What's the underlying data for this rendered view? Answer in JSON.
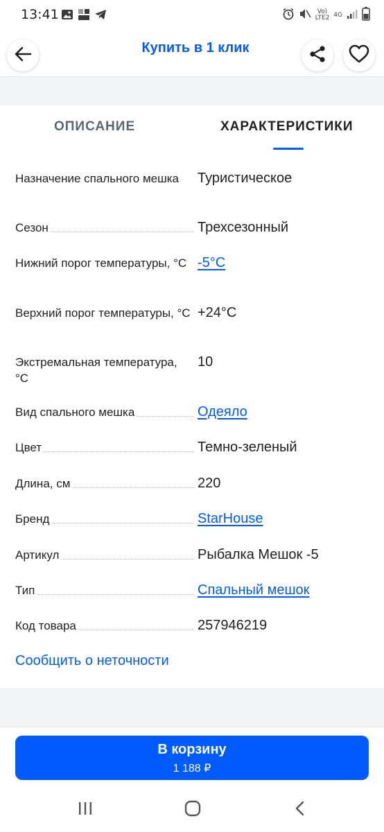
{
  "status_bar": {
    "time": "13:41",
    "network_top": "Vo)",
    "network_bottom": "LTE2",
    "network_type": "4G",
    "icons": [
      "image-icon",
      "app-icon",
      "telegram-icon",
      "alarm-icon",
      "mute-icon",
      "signal-icon",
      "battery-icon"
    ]
  },
  "header": {
    "title": "Купить в 1 клик",
    "back_icon": "arrow-left-icon",
    "share_icon": "share-icon",
    "favorite_icon": "heart-icon"
  },
  "tabs": [
    {
      "label": "ОПИСАНИЕ",
      "active": false
    },
    {
      "label": "ХАРАКТЕРИСТИКИ",
      "active": true
    }
  ],
  "specs": [
    {
      "name": "Назначение спального мешка",
      "value": "Туристическое",
      "link": false
    },
    {
      "name": "Сезон",
      "value": "Трехсезонный",
      "link": false
    },
    {
      "name": "Нижний порог температуры, °C",
      "value": "-5°C",
      "link": true
    },
    {
      "name": "Верхний порог температуры, °C",
      "value": "+24°C",
      "link": false
    },
    {
      "name": "Экстремальная температура, °C",
      "value": "10",
      "link": false
    },
    {
      "name": "Вид спального мешка",
      "value": "Одеяло",
      "link": true
    },
    {
      "name": "Цвет",
      "value": "Темно-зеленый",
      "link": false
    },
    {
      "name": "Длина, см",
      "value": "220",
      "link": false
    },
    {
      "name": "Бренд",
      "value": "StarHouse",
      "link": true
    },
    {
      "name": "Артикул",
      "value": "Рыбалка Мешок -5",
      "link": false
    },
    {
      "name": "Тип",
      "value": "Спальный мешок",
      "link": true
    },
    {
      "name": "Код товара",
      "value": "257946219",
      "link": false
    }
  ],
  "report_link": "Сообщить о неточности",
  "cart": {
    "label": "В корзину",
    "price": "1 188 ₽"
  },
  "nav": {
    "recents_icon": "recents-icon",
    "home_icon": "home-icon",
    "back_icon": "back-chevron-icon"
  },
  "colors": {
    "accent": "#005bff",
    "text": "#1f1f1f",
    "muted": "#5c6670",
    "gap": "#f2f3f5"
  }
}
